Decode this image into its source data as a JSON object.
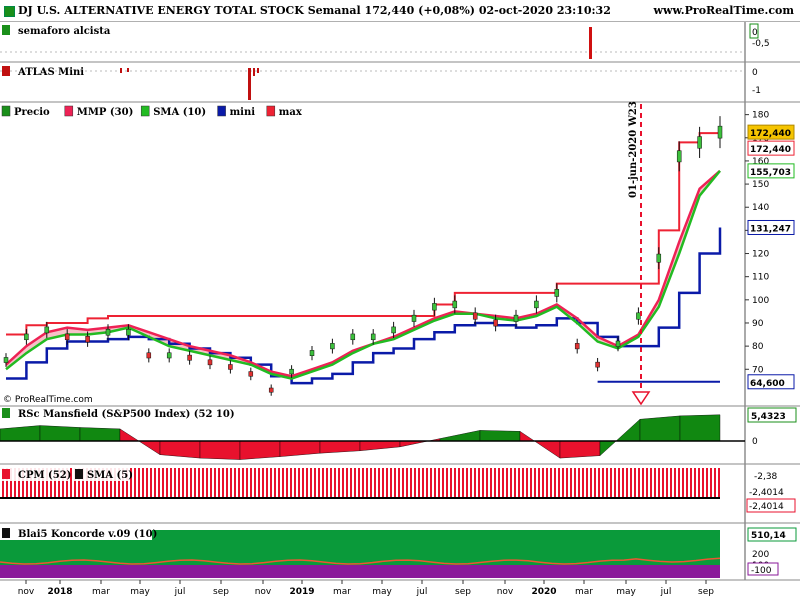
{
  "header": {
    "title": "DJ U.S. ALTERNATIVE ENERGY TOTAL STOCK Semanal 172,440 (+0,08%) 02-oct-2020 23:10:32",
    "site": "www.ProRealTime.com"
  },
  "panels": {
    "semaforo": {
      "label": "semaforo alcista",
      "ticks": [
        "0",
        "-0,5"
      ]
    },
    "atlas": {
      "label": "ATLAS Mini",
      "ticks": [
        "0",
        "-1"
      ]
    },
    "price": {
      "legend": [
        "Precio",
        "MMP (30)",
        "SMA (10)",
        "mini",
        "max"
      ],
      "ticks": [
        "180",
        "170",
        "160",
        "150",
        "140",
        "130",
        "120",
        "110",
        "100",
        "90",
        "80",
        "70"
      ],
      "badges": [
        "172,440",
        "172,440",
        "155,703",
        "131,247",
        "64,600"
      ],
      "annotation": "01-jun-2020 W23",
      "watermark": "© ProRealTime.com"
    },
    "rsc": {
      "label": "RSc Mansfield (S&P500 Index) (52 10)",
      "ticks": [
        "5,4323",
        "0"
      ]
    },
    "cpm": {
      "label_a": "CPM (52)",
      "label_b": "SMA (5)",
      "ticks": [
        "-2,38",
        "-2,4014",
        "-2,4014"
      ]
    },
    "blai5": {
      "label": "Blai5 Koncorde v.09 (10)",
      "ticks": [
        "510,14",
        "200",
        "100",
        "-100"
      ]
    }
  },
  "x_axis": {
    "labels": [
      "nov",
      "2018",
      "mar",
      "may",
      "jul",
      "sep",
      "nov",
      "2019",
      "mar",
      "may",
      "jul",
      "sep",
      "nov",
      "2020",
      "mar",
      "may",
      "jul",
      "sep"
    ]
  },
  "colors": {
    "price_line": "#111111",
    "mmp": "#ee2255",
    "sma": "#22bb22",
    "mini": "#0a1aa8",
    "max": "#ee2233",
    "badge_last": "#f5c400",
    "rsc_pos": "#118811",
    "rsc_neg": "#e8112d",
    "cpm_bar": "#e8112d",
    "blai5_green": "#0a9a3a",
    "blai5_purple": "#8a1a9a"
  },
  "chart_data": [
    {
      "type": "line",
      "title": "DJ U.S. ALTERNATIVE ENERGY TOTAL STOCK Semanal 172,440 (+0,08%) 02-oct-2020 23:10:32",
      "x": [
        "2017-11",
        "2017-12",
        "2018-01",
        "2018-02",
        "2018-03",
        "2018-04",
        "2018-05",
        "2018-06",
        "2018-07",
        "2018-08",
        "2018-09",
        "2018-10",
        "2018-11",
        "2018-12",
        "2019-01",
        "2019-02",
        "2019-03",
        "2019-04",
        "2019-05",
        "2019-06",
        "2019-07",
        "2019-08",
        "2019-09",
        "2019-10",
        "2019-11",
        "2019-12",
        "2020-01",
        "2020-02",
        "2020-03",
        "2020-04",
        "2020-05",
        "2020-06",
        "2020-07",
        "2020-08",
        "2020-09",
        "2020-10"
      ],
      "series": [
        {
          "name": "Precio",
          "values": [
            74,
            84,
            87,
            84,
            83,
            86,
            86,
            76,
            76,
            75,
            73,
            71,
            68,
            61,
            69,
            77,
            80,
            84,
            84,
            87,
            92,
            97,
            98,
            93,
            90,
            92,
            98,
            103,
            80,
            72,
            81,
            93,
            118,
            162,
            168,
            172.44
          ]
        },
        {
          "name": "MMP (30)",
          "values": [
            72,
            80,
            86,
            88,
            87,
            88,
            89,
            86,
            83,
            80,
            78,
            76,
            73,
            69,
            67,
            70,
            73,
            78,
            81,
            84,
            88,
            92,
            95,
            94,
            93,
            92,
            94,
            98,
            92,
            84,
            80,
            85,
            100,
            125,
            148,
            155.703
          ]
        },
        {
          "name": "SMA (10)",
          "values": [
            70,
            77,
            83,
            85,
            85,
            86,
            88,
            84,
            80,
            78,
            76,
            74,
            72,
            68,
            66,
            69,
            72,
            77,
            81,
            83,
            87,
            91,
            94,
            94,
            92,
            91,
            93,
            97,
            90,
            82,
            79,
            84,
            97,
            120,
            145,
            155.703
          ]
        },
        {
          "name": "mini",
          "values": [
            66,
            73,
            79,
            82,
            82,
            83,
            84,
            83,
            81,
            79,
            77,
            75,
            72,
            67,
            64,
            66,
            68,
            73,
            77,
            79,
            83,
            86,
            89,
            90,
            89,
            88,
            89,
            92,
            90,
            84,
            80,
            80,
            88,
            103,
            120,
            131.247
          ]
        },
        {
          "name": "max",
          "values": [
            85,
            89,
            90,
            90,
            92,
            93,
            93,
            93,
            93,
            93,
            93,
            93,
            93,
            93,
            93,
            93,
            93,
            93,
            93,
            93,
            93,
            98,
            103,
            103,
            103,
            103,
            103,
            107,
            107,
            107,
            107,
            107,
            130,
            168,
            172,
            172.44
          ]
        }
      ],
      "ylim": [
        55,
        182
      ]
    },
    {
      "type": "area",
      "title": "RSc Mansfield (S&P500 Index) (52 10)",
      "x": [
        "2017-11",
        "2018-01",
        "2018-03",
        "2018-05",
        "2018-07",
        "2018-09",
        "2018-11",
        "2019-01",
        "2019-03",
        "2019-05",
        "2019-07",
        "2019-09",
        "2019-11",
        "2020-01",
        "2020-03",
        "2020-05",
        "2020-07",
        "2020-09",
        "2020-10"
      ],
      "values": [
        2.5,
        3.2,
        2.8,
        2.5,
        -2.8,
        -3.5,
        -3.8,
        -3.2,
        -2.5,
        -2.0,
        -1.2,
        0.5,
        2.2,
        2.0,
        -3.5,
        -3.0,
        4.5,
        5.2,
        5.4323
      ],
      "ylim": [
        -4.5,
        6.0
      ]
    }
  ]
}
